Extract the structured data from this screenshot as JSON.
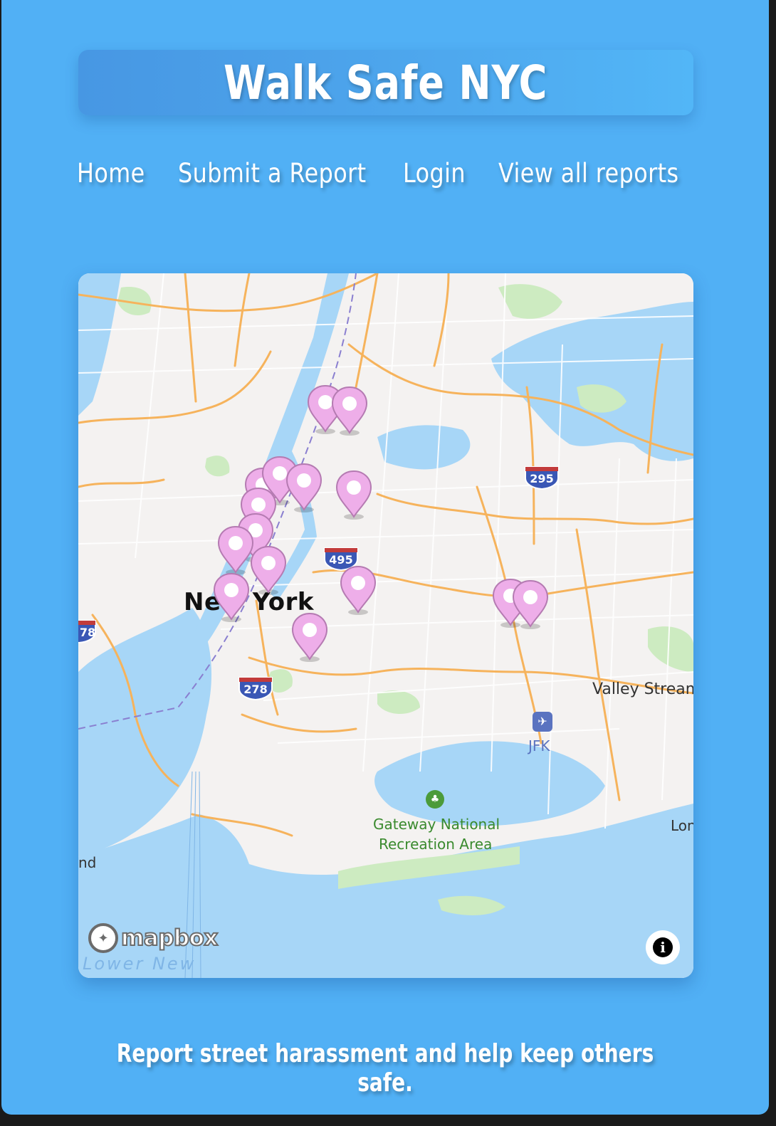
{
  "header": {
    "title": "Walk Safe NYC"
  },
  "nav": {
    "items": [
      {
        "label": "Home"
      },
      {
        "label": "Submit a Report"
      },
      {
        "label": "Login"
      },
      {
        "label": "View all reports"
      }
    ]
  },
  "map": {
    "place_labels": {
      "city": "New York",
      "valley_stream": "Valley Stream",
      "jfk": "JFK",
      "gateway": "Gateway National",
      "gateway2": "Recreation Area",
      "long_partial": "Lon",
      "island_partial": "nd",
      "lower_new": "Lower New"
    },
    "highway_shields": {
      "i295": "295",
      "i495": "495",
      "i278": "278",
      "i78": "78"
    },
    "attribution": {
      "logo_text": "mapbox",
      "info_icon": "info-icon"
    },
    "marker_color": "#eeaee9",
    "marker_count": 17
  },
  "footer": {
    "tagline": "Report street harassment and help keep others safe."
  },
  "colors": {
    "page_background": "#51b0f5",
    "title_box": "#4797e3",
    "water": "#a7d6f7",
    "land": "#f4f2f1",
    "park": "#cdebc1",
    "road_major": "#f6b35c",
    "marker_fill": "#eeaee9",
    "marker_stroke": "#b57bb2"
  }
}
